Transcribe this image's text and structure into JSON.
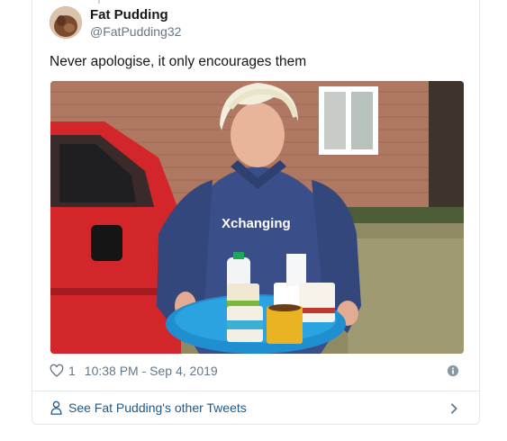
{
  "tweet": {
    "author": {
      "name": "Fat Pudding",
      "handle": "@FatPudding32"
    },
    "text": "Never apologise, it only encourages them",
    "media": {
      "shirt_logo": "Xchanging"
    },
    "like_count": "1",
    "timestamp": "10:38 PM - Sep 4, 2019",
    "footer_link": "See Fat Pudding's other Tweets",
    "icons": {
      "like": "heart-icon",
      "info": "info-icon",
      "profile": "person-icon",
      "more": "chevron-right-icon"
    },
    "colors": {
      "link": "#1b5a8f",
      "secondary": "#657786",
      "border": "#e1e8ed"
    }
  }
}
